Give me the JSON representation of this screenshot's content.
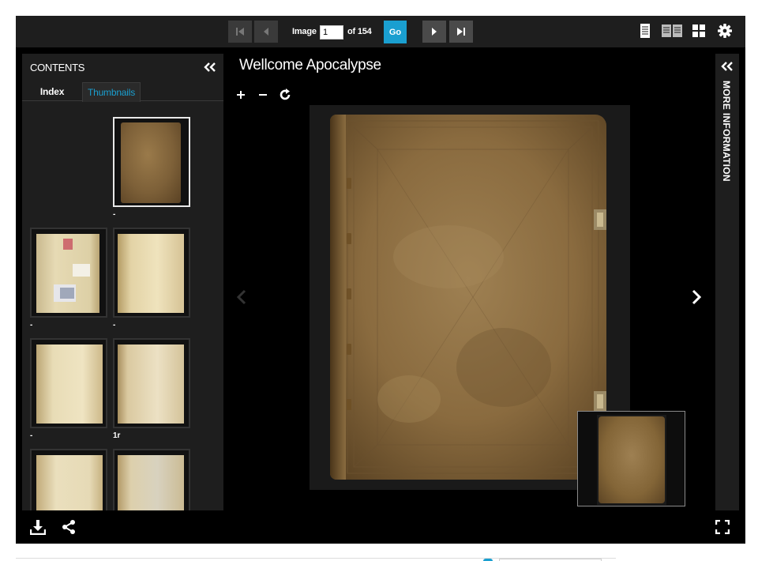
{
  "toolbar": {
    "image_label": "Image",
    "image_value": "1",
    "of_label": "of 154",
    "go_label": "Go"
  },
  "contents": {
    "title": "CONTENTS",
    "tabs": [
      {
        "label": "Index",
        "active": false
      },
      {
        "label": "Thumbnails",
        "active": true
      }
    ],
    "thumbnails": [
      {
        "label": "-",
        "selected": true
      },
      {
        "label": "-",
        "selected": false
      },
      {
        "label": "-",
        "selected": false
      },
      {
        "label": "-",
        "selected": false
      },
      {
        "label": "1r",
        "selected": false
      },
      {
        "label": "",
        "selected": false
      },
      {
        "label": "",
        "selected": false
      }
    ]
  },
  "main": {
    "title": "Wellcome Apocalypse"
  },
  "right_panel": {
    "label": "MORE INFORMATION"
  },
  "icons": {
    "first": "first-page-icon",
    "prev": "previous-page-icon",
    "next": "next-page-icon",
    "last": "last-page-icon",
    "one_up": "one-up-view-icon",
    "two_up": "two-up-view-icon",
    "gallery": "gallery-view-icon",
    "settings": "gear-icon",
    "collapse": "double-chevron-left-icon",
    "zoom_in": "plus-icon",
    "zoom_out": "minus-icon",
    "rotate": "rotate-icon",
    "download": "download-icon",
    "share": "share-icon",
    "fullscreen": "fullscreen-icon"
  },
  "colors": {
    "accent": "#1a9fd0",
    "panel": "#1e1e1e",
    "viewer_bg": "#000000"
  }
}
